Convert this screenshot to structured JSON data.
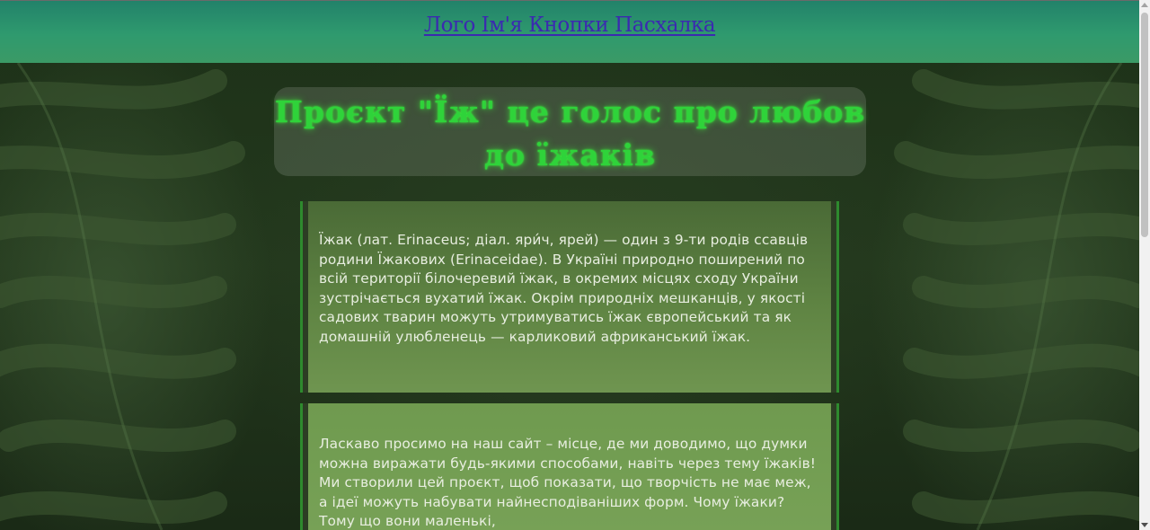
{
  "header": {
    "nav_label": "Лого Ім'я Кнопки Пасхалка"
  },
  "hero": {
    "title": "Проєкт \"Їж\" це голос про любов до їжаків"
  },
  "cards": [
    {
      "text": "Їжак (лат. Erinaceus; діал. яри́ч, ярей) — один з 9-ти родів ссавців родини Їжакових (Erinaceidae). В Україні природно поширений по всій території білочеревий їжак, в окремих місцях сходу України зустрічається вухатий їжак. Окрім природніх мешканців, у якості садових тварин можуть утримуватись їжак європейський та як домашній улюбленець — карликовий африканський їжак."
    },
    {
      "text": "Ласкаво просимо на наш сайт – місце, де ми доводимо, що думки можна виражати будь-якими способами, навіть через тему їжаків! Ми створили цей проєкт, щоб показати, що творчість не має меж, а ідеї можуть набувати найнесподіваніших форм. Чому їжаки? Тому що вони маленькі,"
    }
  ],
  "colors": {
    "header_gradient_start": "#22826a",
    "header_gradient_end": "#3b9a66",
    "nav_link": "#3b2ab0",
    "title_glow": "#2fd33a",
    "card_border": "#2e8a2e",
    "page_background": "#1b2c17"
  },
  "icons": {
    "scroll_up": "chevron-up-icon",
    "scroll_down": "chevron-down-icon"
  }
}
